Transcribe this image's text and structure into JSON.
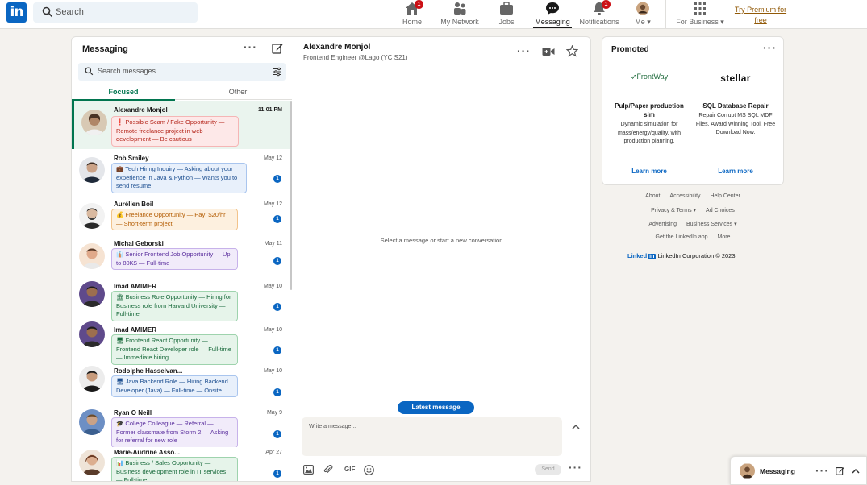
{
  "nav": {
    "search_placeholder": "Search",
    "items": [
      {
        "label": "Home",
        "icon": "home-icon",
        "badge": "1"
      },
      {
        "label": "My Network",
        "icon": "network-icon",
        "badge": ""
      },
      {
        "label": "Jobs",
        "icon": "briefcase-icon",
        "badge": ""
      },
      {
        "label": "Messaging",
        "icon": "messaging-icon",
        "badge": ""
      },
      {
        "label": "Notifications",
        "icon": "bell-icon",
        "badge": "1"
      },
      {
        "label": "Me",
        "icon": "avatar-icon",
        "badge": ""
      },
      {
        "label": "For Business",
        "icon": "grid-icon",
        "badge": ""
      }
    ],
    "premium_line1": "Try Premium for",
    "premium_line2": "free"
  },
  "messaging": {
    "title": "Messaging",
    "search_placeholder": "Search messages",
    "tabs": [
      "Focused",
      "Other"
    ],
    "conversations": [
      {
        "name": "Alexandre Monjol",
        "date": "11:01 PM",
        "preview": "❗ Possible Scam / Fake Opportunity — Remote freelance project in web development — Be cautious",
        "tone": "red",
        "unread": ""
      },
      {
        "name": "Rob Smiley",
        "date": "May 12",
        "preview": "💼 Tech Hiring Inquiry — Asking about your experience in Java & Python — Wants you to send resume",
        "tone": "blue",
        "unread": "1"
      },
      {
        "name": "Aurélien Boil",
        "date": "May 12",
        "preview": "💰 Freelance Opportunity — Pay: $20/hr — Short-term project",
        "tone": "orange",
        "unread": "1"
      },
      {
        "name": "Michal Geborski",
        "date": "May 11",
        "preview": "👔 Senior Frontend Job Opportunity — Up to 80K$ — Full-time",
        "tone": "purple",
        "unread": "1"
      },
      {
        "name": "Imad AMIMER",
        "date": "May 10",
        "preview": "🏛 Business Role Opportunity — Hiring for Business role from Harvard University — Full-time",
        "tone": "green",
        "unread": "1"
      },
      {
        "name": "Imad AMIMER",
        "date": "May 10",
        "preview": "🖥 Frontend React Opportunity — Frontend React Developer role — Full-time — Immediate hiring",
        "tone": "green",
        "unread": "1"
      },
      {
        "name": "Rodolphe Hasselvan...",
        "date": "May 10",
        "preview": "🖥 Java Backend Role — Hiring Backend Developer (Java) — Full-time — Onsite",
        "tone": "blue",
        "unread": "1"
      },
      {
        "name": "Ryan O Neill",
        "date": "May 9",
        "preview": "🎓 College Colleague — Referral — Former classmate from Storm 2 — Asking for referral for new role",
        "tone": "purple",
        "unread": "1"
      },
      {
        "name": "Marie-Audrine Asso...",
        "date": "Apr 27",
        "preview": "📊 Business / Sales Opportunity — Business development role in IT services — Full-time",
        "tone": "green",
        "unread": "1"
      }
    ]
  },
  "conversation": {
    "name": "Alexandre Monjol",
    "headline": "Frontend Engineer @Lago (YC S21)",
    "empty_text": "Select a message or start a new conversation",
    "latest_label": "Latest message",
    "input_placeholder": "Write a message...",
    "gif_label": "GIF",
    "send_label": "Send"
  },
  "promoted": {
    "title": "Promoted",
    "ads": [
      {
        "brand": "FrontWay",
        "title": "Pulp/Paper production sim",
        "desc": "Dynamic simulation for mass/energy/quality, with production planning.",
        "cta": "Learn more"
      },
      {
        "brand": "stellar",
        "title": "SQL Database Repair",
        "desc": "Repair Corrupt MS SQL MDF Files. Award Winning Tool. Free Download Now.",
        "cta": "Learn more"
      }
    ]
  },
  "footer": {
    "row1": [
      "About",
      "Accessibility",
      "Help Center"
    ],
    "row2": [
      "Privacy & Terms ▾",
      "Ad Choices"
    ],
    "row3": [
      "Advertising",
      "Business Services ▾"
    ],
    "row4": [
      "Get the LinkedIn app",
      "More"
    ],
    "brand_text": "Linked",
    "brand_in": "in",
    "copyright": "LinkedIn Corporation © 2023"
  },
  "dock": {
    "label": "Messaging"
  },
  "colors": {
    "brand": "#0a66c2",
    "focus_green": "#01754f",
    "badge_red": "#cc1016"
  }
}
